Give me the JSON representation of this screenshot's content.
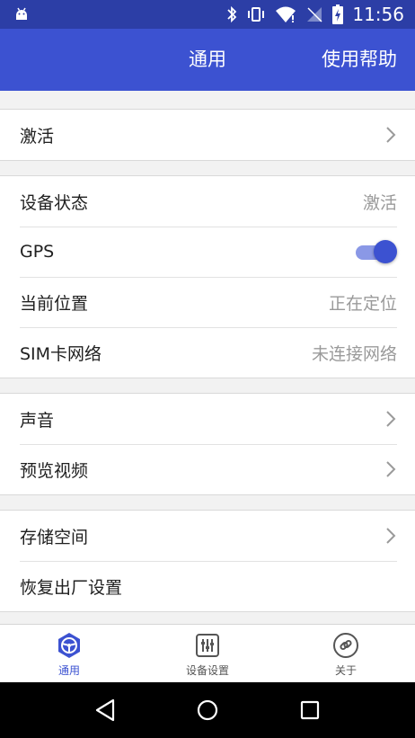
{
  "status_bar": {
    "time": "11:56",
    "icons": [
      "android-icon",
      "bluetooth-icon",
      "vibrate-icon",
      "wifi-icon",
      "no-sim-icon",
      "battery-charging-icon"
    ]
  },
  "app_bar": {
    "title": "通用",
    "action_label": "使用帮助"
  },
  "groups": [
    {
      "items": [
        {
          "label": "激活",
          "type": "link"
        }
      ]
    },
    {
      "items": [
        {
          "label": "设备状态",
          "type": "value",
          "value": "激活"
        },
        {
          "label": "GPS",
          "type": "toggle",
          "on": true
        },
        {
          "label": "当前位置",
          "type": "value",
          "value": "正在定位"
        },
        {
          "label": "SIM卡网络",
          "type": "value",
          "value": "未连接网络"
        }
      ]
    },
    {
      "items": [
        {
          "label": "声音",
          "type": "link"
        },
        {
          "label": "预览视频",
          "type": "link"
        }
      ]
    },
    {
      "items": [
        {
          "label": "存储空间",
          "type": "link"
        },
        {
          "label": "恢复出厂设置",
          "type": "plain"
        }
      ]
    }
  ],
  "bottom_nav": {
    "active_color": "#3c52d1",
    "items": [
      {
        "label": "通用",
        "icon": "steering-wheel-icon",
        "active": true
      },
      {
        "label": "设备设置",
        "icon": "sliders-icon",
        "active": false
      },
      {
        "label": "关于",
        "icon": "link-icon",
        "active": false
      }
    ]
  },
  "system_nav": [
    "back-icon",
    "home-icon",
    "recents-icon"
  ],
  "colors": {
    "status_bar": "#2c3ea6",
    "app_bar": "#3c52d1",
    "toggle_on": "#3c52d1"
  }
}
